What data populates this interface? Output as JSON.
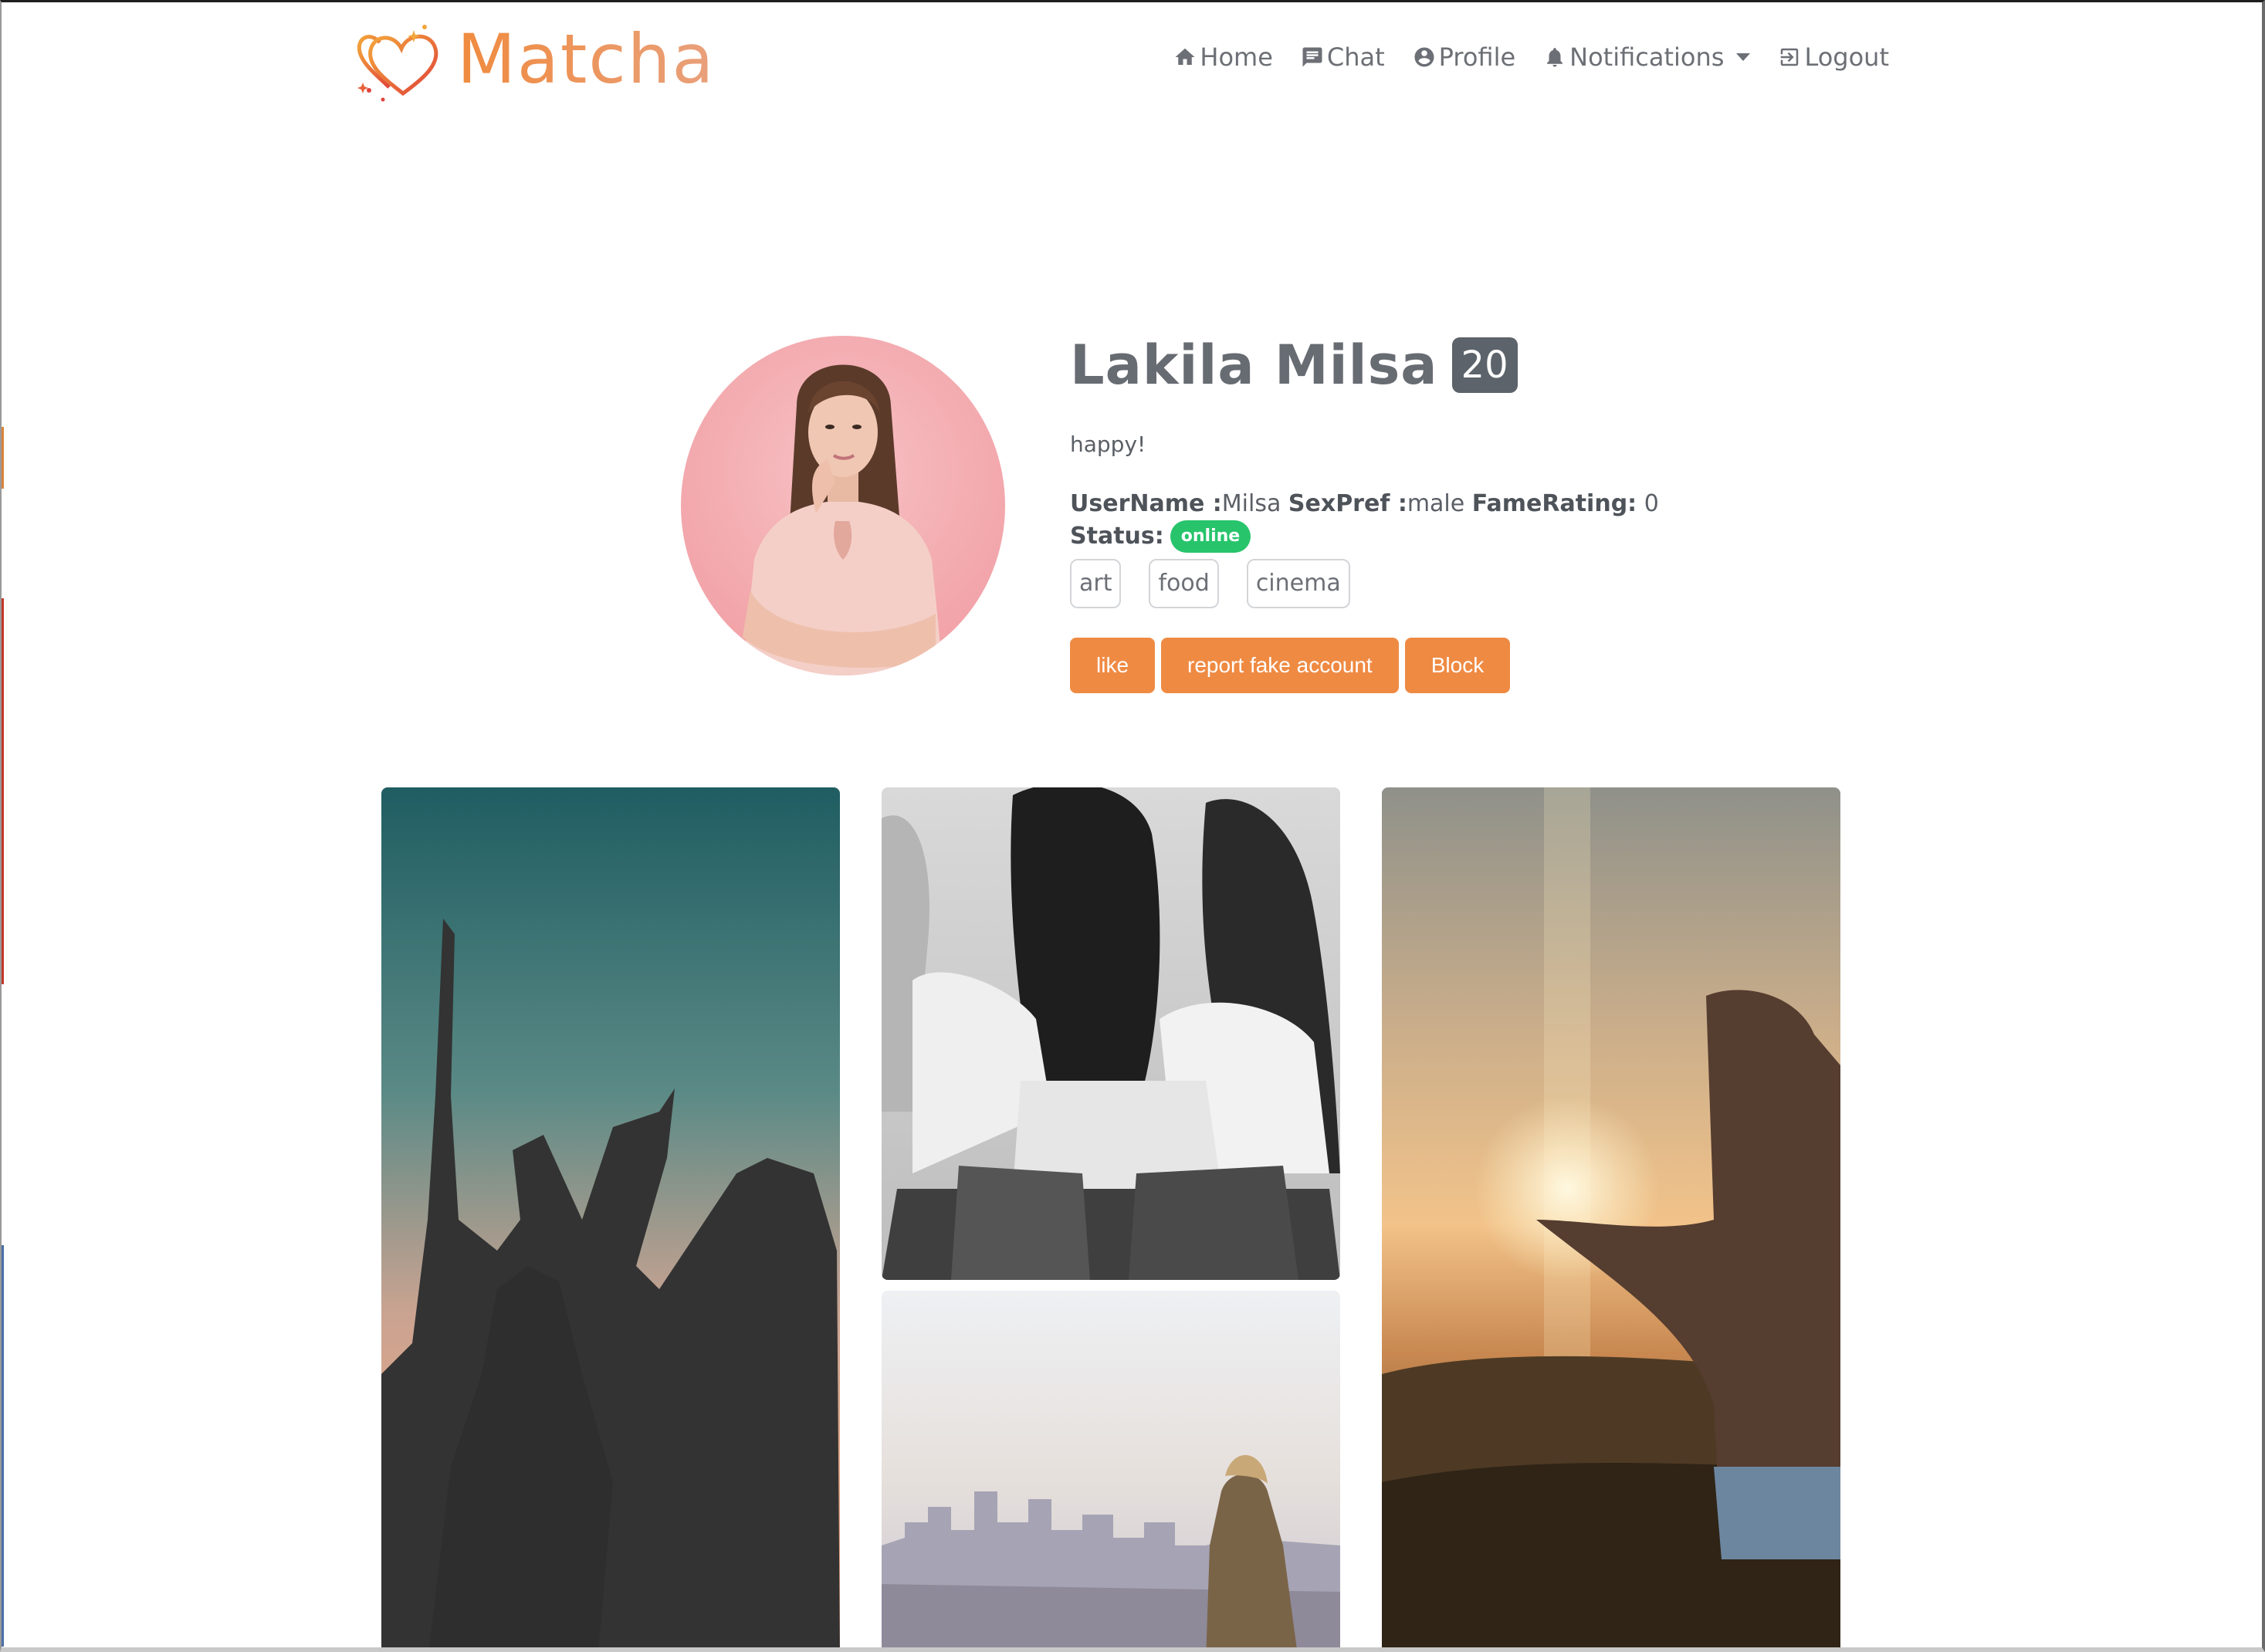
{
  "navbar": {
    "brand": "Matcha",
    "links": [
      {
        "label": "Home",
        "icon": "home-icon"
      },
      {
        "label": "Chat",
        "icon": "chat-icon"
      },
      {
        "label": "Profile",
        "icon": "profile-icon"
      },
      {
        "label": "Notifications",
        "icon": "bell-icon"
      },
      {
        "label": "Logout",
        "icon": "logout-icon"
      }
    ]
  },
  "profile": {
    "full_name": "Lakila Milsa",
    "age": "20",
    "bio": "happy!",
    "username_label": "UserName :",
    "username": "Milsa",
    "sexpref_label": "SexPref :",
    "sexpref": "male",
    "fame_label": "FameRating:",
    "fame_rating": "0",
    "status_label": "Status:",
    "status": "online",
    "tags": [
      "art",
      "food",
      "cinema"
    ]
  },
  "actions": {
    "like": "like",
    "report": "report fake account",
    "block": "Block"
  },
  "colors": {
    "accent": "#ef8a43",
    "online": "#27c46b",
    "badge": "#5c636a"
  }
}
